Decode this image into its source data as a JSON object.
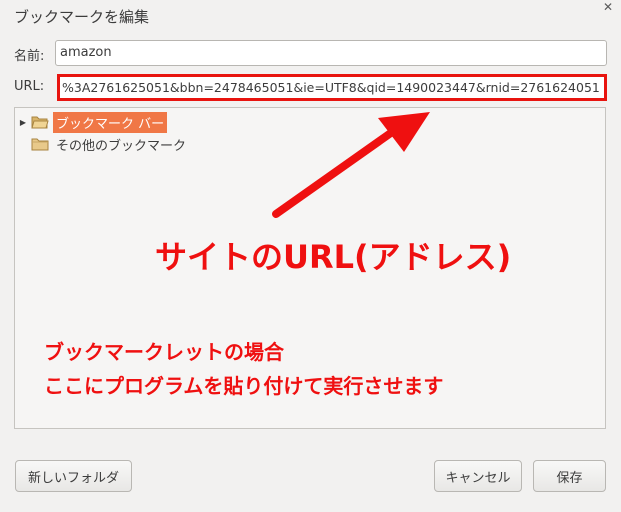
{
  "window": {
    "title": "ブックマークを編集",
    "close_glyph": "✕"
  },
  "form": {
    "name_label": "名前:",
    "name_value": "amazon",
    "url_label": "URL:",
    "url_value": "%3A2761625051&bbn=2478465051&ie=UTF8&qid=1490023447&rnid=2761624051"
  },
  "tree": {
    "items": [
      {
        "label": "ブックマーク バー",
        "icon": "folder-open-icon",
        "expandable": true,
        "selected": true
      },
      {
        "label": "その他のブックマーク",
        "icon": "folder-icon",
        "expandable": false,
        "selected": false
      }
    ]
  },
  "annotations": {
    "url_note": "サイトのURL(アドレス)",
    "bookmarklet_note_line1": "ブックマークレットの場合",
    "bookmarklet_note_line2": "ここにプログラムを貼り付けて実行させます"
  },
  "buttons": {
    "new_folder": "新しいフォルダ",
    "cancel": "キャンセル",
    "save": "保存"
  },
  "colors": {
    "annotation_red": "#ef1010",
    "selection_orange": "#f07746",
    "folder_tan": "#e8c98a"
  }
}
